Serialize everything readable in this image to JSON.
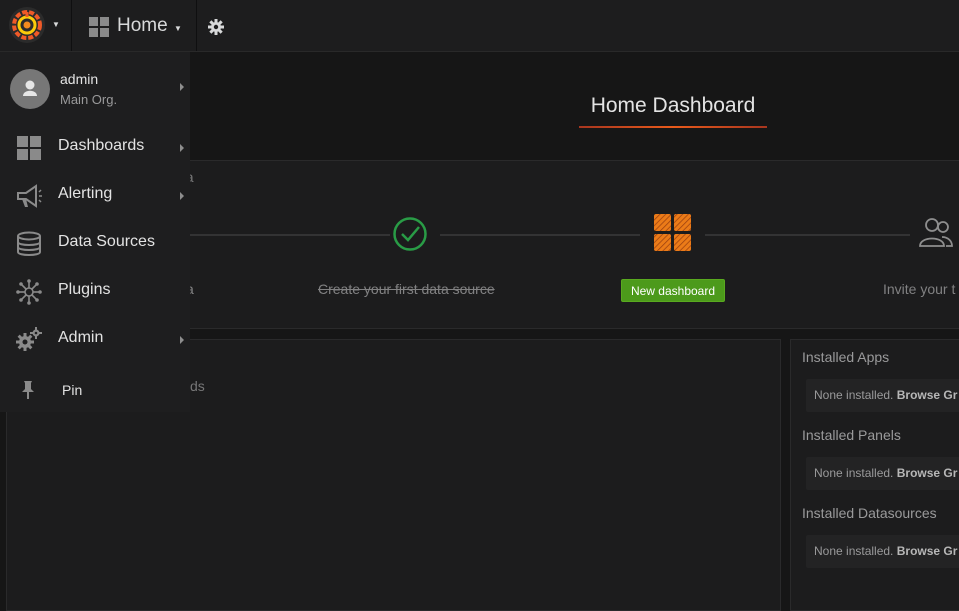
{
  "topnav": {
    "home_label": "Home"
  },
  "dashboard": {
    "title": "Home Dashboard"
  },
  "progress": {
    "partial_header": "na",
    "partial_step_label": "a",
    "step_create_datasource": "Create your first data source",
    "new_dashboard_button": "New dashboard",
    "partial_invite": "Invite your t"
  },
  "left_panel": {
    "partial_text": "ds"
  },
  "right_panel": {
    "sections": [
      {
        "heading": "Installed Apps",
        "none_text": "None installed.",
        "browse_text": "Browse Gr"
      },
      {
        "heading": "Installed Panels",
        "none_text": "None installed.",
        "browse_text": "Browse Gr"
      },
      {
        "heading": "Installed Datasources",
        "none_text": "None installed.",
        "browse_text": "Browse Gr"
      }
    ]
  },
  "sidemenu": {
    "user": {
      "name": "admin",
      "org": "Main Org."
    },
    "items": [
      {
        "label": "Dashboards",
        "icon": "dashboards-icon"
      },
      {
        "label": "Alerting",
        "icon": "alerting-icon"
      },
      {
        "label": "Data Sources",
        "icon": "datasources-icon"
      },
      {
        "label": "Plugins",
        "icon": "plugins-icon"
      },
      {
        "label": "Admin",
        "icon": "admin-icon"
      },
      {
        "label": "Pin",
        "icon": "pin-icon"
      }
    ]
  },
  "colors": {
    "accent_orange": "#eb7b18",
    "success_green": "#299c46",
    "button_green": "#4c9a1b"
  }
}
